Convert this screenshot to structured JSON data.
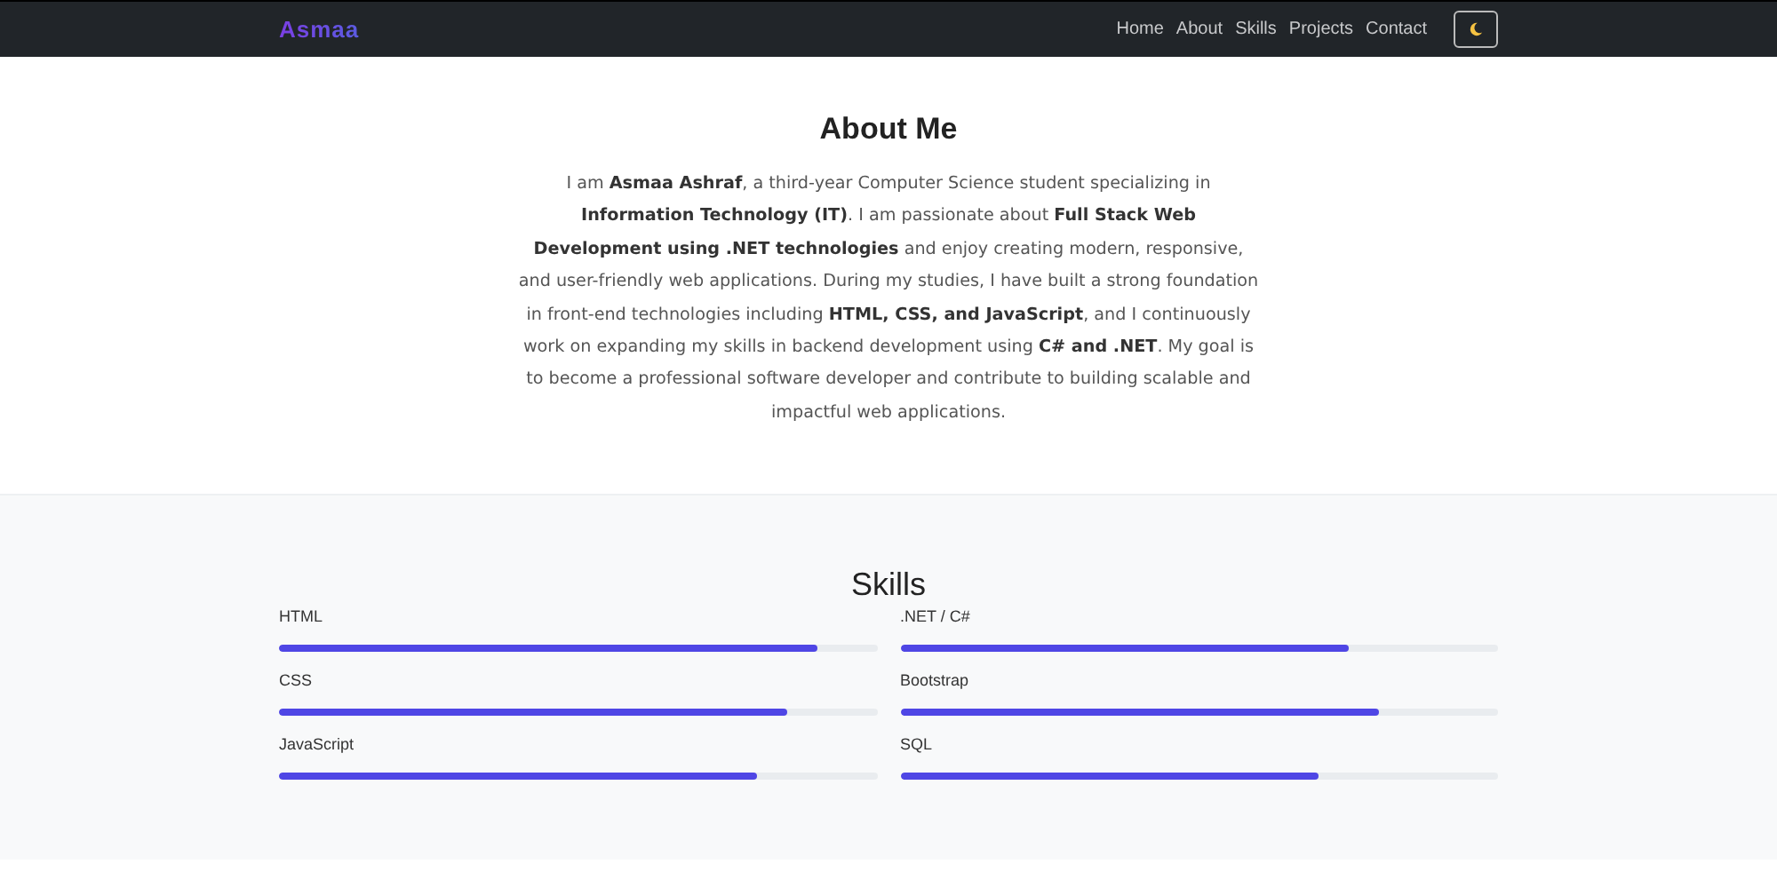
{
  "navbar": {
    "brand": "Asmaa",
    "links": [
      {
        "label": "Home"
      },
      {
        "label": "About"
      },
      {
        "label": "Skills"
      },
      {
        "label": "Projects"
      },
      {
        "label": "Contact"
      }
    ]
  },
  "about": {
    "title": "About Me",
    "text": "I am **Asmaa Ashraf**, a third-year Computer Science student specializing in **Information Technology (IT)**. I am passionate about **Full Stack Web Development using .NET technologies** and enjoy creating modern, responsive, and user-friendly web applications. During my studies, I have built a strong foundation in front-end technologies including **HTML, CSS, and JavaScript**, and I continuously work on expanding my skills in backend development using **C# and .NET**. My goal is to become a professional software developer and contribute to building scalable and impactful web applications."
  },
  "skills": {
    "title": "Skills",
    "items": [
      {
        "name": "HTML",
        "level": 0.9
      },
      {
        "name": ".NET / C#",
        "level": 0.75
      },
      {
        "name": "CSS",
        "level": 0.85
      },
      {
        "name": "Bootstrap",
        "level": 0.8
      },
      {
        "name": "JavaScript",
        "level": 0.8
      },
      {
        "name": "SQL",
        "level": 0.7
      }
    ]
  }
}
